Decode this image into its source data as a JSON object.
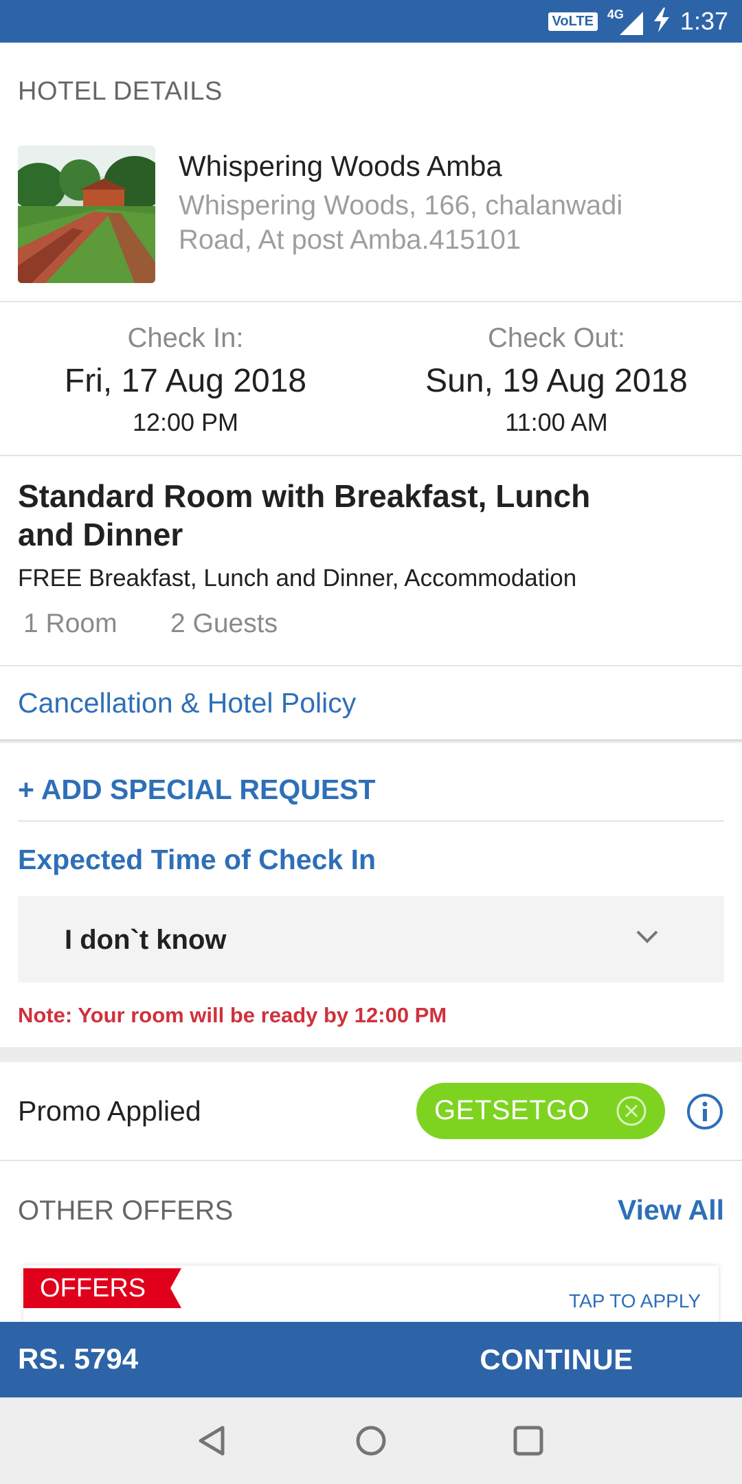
{
  "status_bar": {
    "volte_label": "VoLTE",
    "network_label": "4G",
    "time": "1:37"
  },
  "hotel": {
    "section_title": "HOTEL DETAILS",
    "name": "Whispering Woods Amba",
    "address": "Whispering Woods, 166, chalanwadi Road, At post Amba.415101"
  },
  "check_in": {
    "label": "Check In:",
    "date": "Fri, 17 Aug 2018",
    "time": "12:00 PM"
  },
  "check_out": {
    "label": "Check Out:",
    "date": "Sun, 19 Aug 2018",
    "time": "11:00 AM"
  },
  "room": {
    "title": "Standard Room with Breakfast, Lunch and Dinner",
    "inclusions": "FREE Breakfast, Lunch and Dinner, Accommodation",
    "rooms": "1 Room",
    "guests": "2 Guests"
  },
  "policy_link": "Cancellation & Hotel Policy",
  "special_request": "+ ADD SPECIAL REQUEST",
  "expected_checkin": {
    "heading": "Expected Time of Check In",
    "selected": "I don`t know",
    "note": "Note: Your room will be ready by 12:00 PM"
  },
  "promo": {
    "label": "Promo Applied",
    "code": "GETSETGO"
  },
  "offers": {
    "heading": "OTHER OFFERS",
    "view_all": "View All",
    "tag": "OFFERS",
    "tap_to_apply": "TAP TO APPLY"
  },
  "bottom_bar": {
    "price": "RS. 5794",
    "continue": "CONTINUE"
  },
  "colors": {
    "brand_blue": "#2d64a8",
    "link_blue": "#2e6fb7",
    "promo_green": "#7ed321",
    "note_red": "#d0313c",
    "offer_red": "#e0001b"
  }
}
